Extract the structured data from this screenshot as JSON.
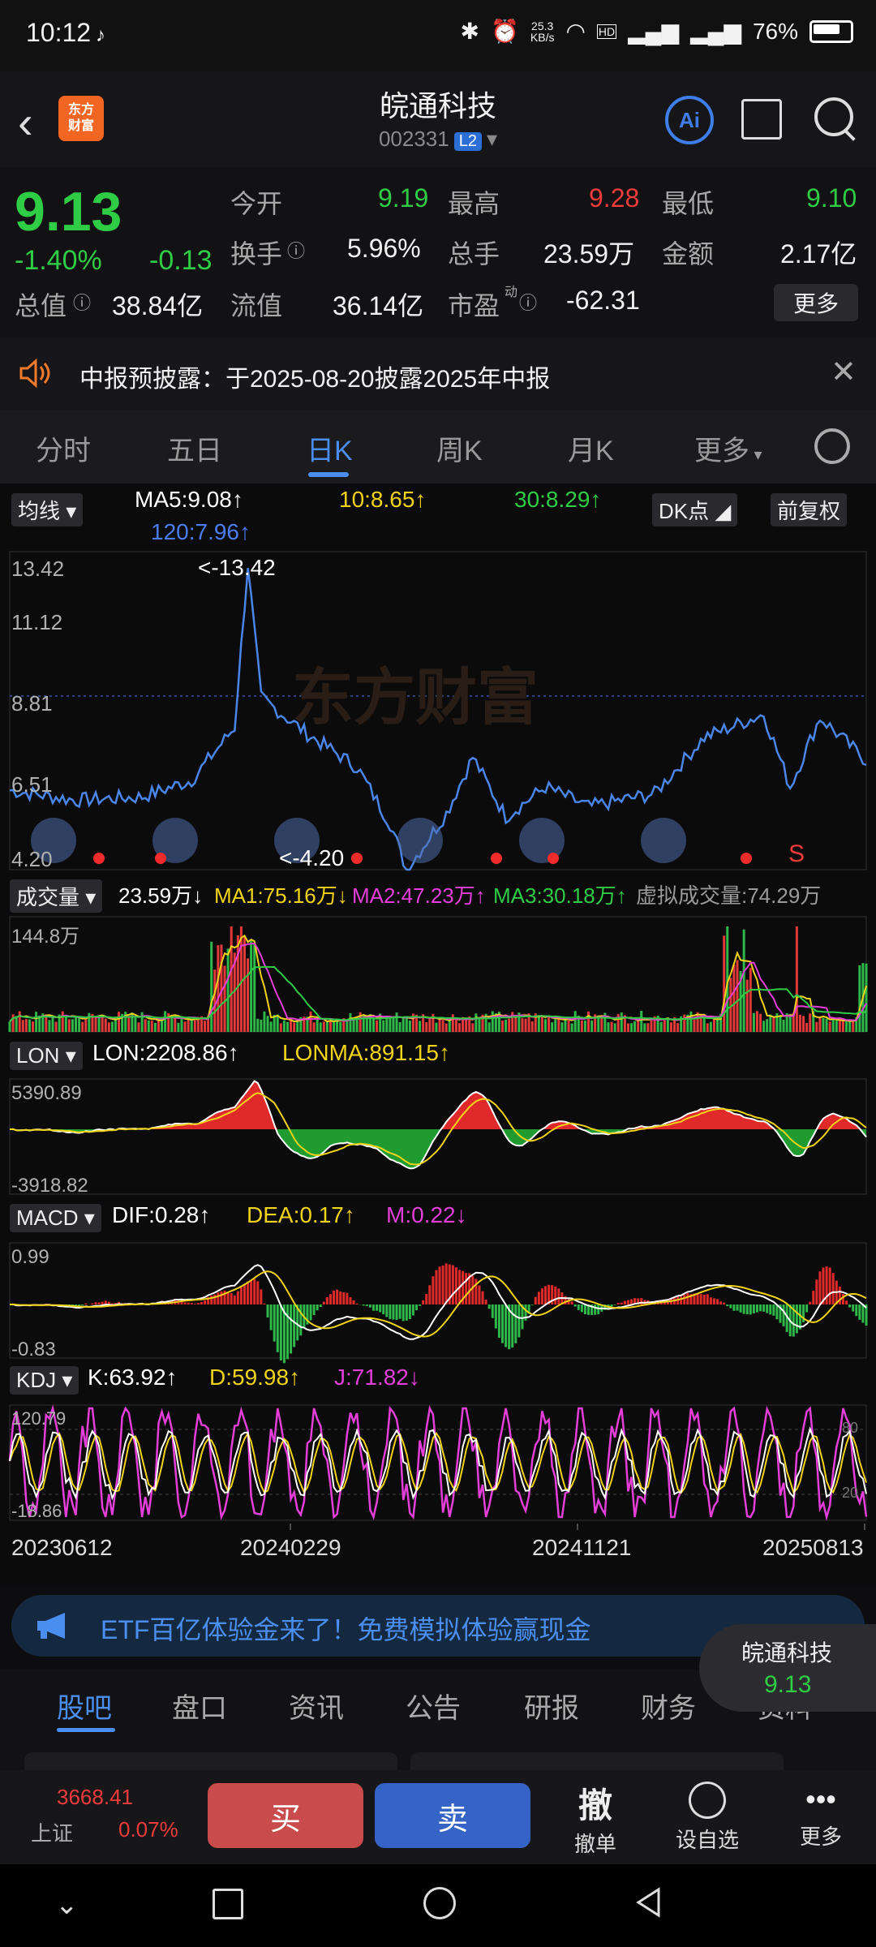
{
  "status": {
    "time": "10:12",
    "speed": "25.3\nKB/s",
    "battery": "76%",
    "icons": [
      "tiktok-icon",
      "bluetooth-icon",
      "alarm-icon",
      "wifi-icon",
      "hd-icon",
      "signal-5g-icon",
      "signal-5g-icon",
      "battery-icon"
    ]
  },
  "header": {
    "title": "皖通科技",
    "code": "002331",
    "level": "L2",
    "logo_text": "东方\n财富"
  },
  "quote": {
    "price": "9.13",
    "pct": "-1.40%",
    "change": "-0.13",
    "open_label": "今开",
    "open": "9.19",
    "high_label": "最高",
    "high": "9.28",
    "low_label": "最低",
    "low": "9.10",
    "turnover_label": "换手",
    "turnover": "5.96%",
    "vol_label": "总手",
    "vol": "23.59万",
    "amount_label": "金额",
    "amount": "2.17亿",
    "mcap_label": "总值",
    "mcap": "38.84亿",
    "float_label": "流值",
    "float": "36.14亿",
    "pe_label": "市盈",
    "pe_sup": "动",
    "pe": "-62.31",
    "more": "更多"
  },
  "notice": {
    "text": "中报预披露：于2025-08-20披露2025年中报"
  },
  "tabs": [
    "分时",
    "五日",
    "日K",
    "周K",
    "月K",
    "更多"
  ],
  "active_tab": "日K",
  "chart": {
    "ma_chip": "均线",
    "ma5": "MA5:9.08↑",
    "ma10": "10:8.65↑",
    "ma30": "30:8.29↑",
    "ma120": "120:7.96↑",
    "dk_chip": "DK点",
    "adj_chip": "前复权",
    "y_ticks": [
      "13.42",
      "11.12",
      "8.81",
      "6.51",
      "4.20"
    ],
    "max_label": "<-13.42",
    "min_label": "<-4.20",
    "watermark": "东方财富",
    "sell_mark": "S",
    "vol_chip": "成交量",
    "vol_now": "23.59万↓",
    "vol_ma1": "MA1:75.16万↓",
    "vol_ma2": "MA2:47.23万↑",
    "vol_ma3": "MA3:30.18万↑",
    "vol_virtual": "虚拟成交量:74.29万",
    "vol_max": "144.8万",
    "lon_chip": "LON",
    "lon": "LON:2208.86↑",
    "lonma": "LONMA:891.15↑",
    "lon_max": "5390.89",
    "lon_min": "-3918.82",
    "macd_chip": "MACD",
    "dif": "DIF:0.28↑",
    "dea": "DEA:0.17↑",
    "m": "M:0.22↓",
    "macd_max": "0.99",
    "macd_min": "-0.83",
    "kdj_chip": "KDJ",
    "k": "K:63.92↑",
    "d": "D:59.98↑",
    "j": "J:71.82↓",
    "kdj_max": "120.79",
    "kdj_min": "-18.86",
    "kdj_80": "80",
    "kdj_20": "20",
    "dates": [
      "20230612",
      "20240229",
      "20241121",
      "20250813"
    ]
  },
  "chart_data": {
    "type": "line",
    "title": "",
    "x": [
      "20230612",
      "20240229",
      "20241121",
      "20250813"
    ],
    "ylim": [
      4.2,
      13.42
    ],
    "series": [
      {
        "name": "",
        "values_approx": [
          6.5,
          13.42,
          4.2,
          9.13
        ]
      }
    ]
  },
  "etf": {
    "text": "ETF百亿体验金来了！免费模拟体验赢现金"
  },
  "float_card": {
    "name": "皖通科技",
    "price": "9.13"
  },
  "bottom_tabs": [
    "股吧",
    "盘口",
    "资讯",
    "公告",
    "研报",
    "财务",
    "资料"
  ],
  "toolbar": {
    "index_value": "3668.41",
    "index_name": "上证",
    "index_pct": "0.07%",
    "buy": "买",
    "sell": "卖",
    "cancel": "撤单",
    "cancel_icon": "撤",
    "watch": "设自选",
    "more": "更多"
  }
}
